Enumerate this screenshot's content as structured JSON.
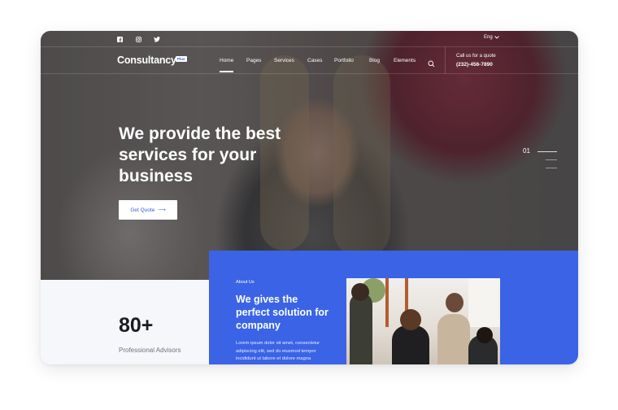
{
  "topbar": {
    "social": [
      {
        "name": "facebook-icon",
        "glyph": "f"
      },
      {
        "name": "instagram-icon",
        "glyph": "◎"
      },
      {
        "name": "twitter-icon",
        "glyph": "✓"
      }
    ],
    "language": "Eng"
  },
  "navbar": {
    "logo": "Consultancy",
    "logo_badge": "Plus",
    "items": [
      "Home",
      "Pages",
      "Services",
      "Cases",
      "Portfolio",
      "Blog",
      "Elements"
    ],
    "active": "Home",
    "call_label": "Call us for a quote",
    "call_number": "(232)-456-7890"
  },
  "hero": {
    "headline": "We provide the best services for your business",
    "cta_label": "Get Quote",
    "cta_arrow": "⟶",
    "slide_number": "01"
  },
  "stats": {
    "value": "80+",
    "label": "Professional Advisors"
  },
  "about": {
    "eyebrow": "About Us",
    "title": "We gives the perfect solution for company",
    "body": "Lorem ipsum dolor sit amet, consectetur adipiscing elit, sed do eiusmod tempor incididunt ut labore et dolore magna"
  },
  "colors": {
    "accent": "#3a63e6",
    "cta_text": "#3a5bd9",
    "stat_text": "#1b1b22"
  }
}
